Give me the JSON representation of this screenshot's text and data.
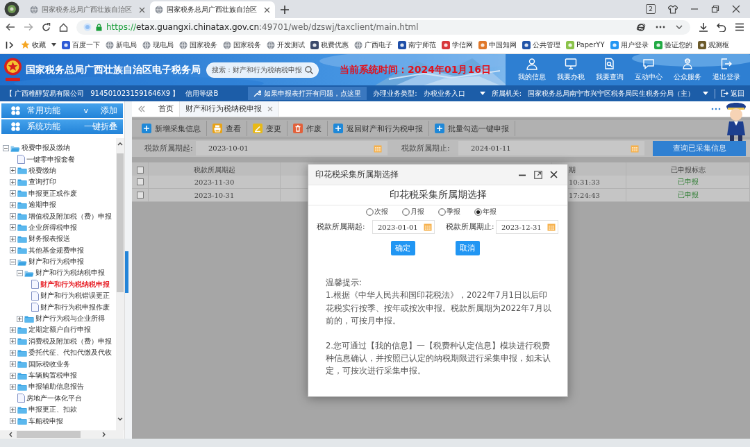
{
  "browser": {
    "tabs": [
      {
        "title": "国家税务总局广西壮族自治区",
        "selected": false
      },
      {
        "title": "国家税务总局广西壮族自治区",
        "selected": true
      }
    ],
    "tab_count": "2",
    "url": {
      "scheme": "https://",
      "host": "etax.guangxi.chinatax.gov.cn",
      "path": ":49701/web/dzswj/taxclient/main.html"
    },
    "bookmarks": [
      {
        "label": "收藏",
        "kind": "star"
      },
      {
        "label": "百度一下",
        "kind": "tile",
        "color": "#2f5bd6"
      },
      {
        "label": "新电局",
        "kind": "globe"
      },
      {
        "label": "现电局",
        "kind": "globe"
      },
      {
        "label": "国家税务",
        "kind": "globe"
      },
      {
        "label": "国家税务",
        "kind": "globe"
      },
      {
        "label": "开发测试",
        "kind": "globe"
      },
      {
        "label": "税费优惠",
        "kind": "tile",
        "color": "#3b4a6b"
      },
      {
        "label": "广西电子",
        "kind": "globe"
      },
      {
        "label": "南宁师范",
        "kind": "tile",
        "color": "#1f4fa8"
      },
      {
        "label": "学信网",
        "kind": "tile",
        "color": "#d8363a"
      },
      {
        "label": "中国知网",
        "kind": "tile",
        "color": "#e0782a"
      },
      {
        "label": "公共管理",
        "kind": "tile",
        "color": "#2254a8"
      },
      {
        "label": "PaperYY",
        "kind": "tile",
        "color": "#8bc34a"
      },
      {
        "label": "用户登录",
        "kind": "tile",
        "color": "#2196f3"
      },
      {
        "label": "验证您的",
        "kind": "tile",
        "color": "#22aa44"
      },
      {
        "label": "观测枢",
        "kind": "tile",
        "color": "#6b5a2a"
      }
    ]
  },
  "header": {
    "title": "国家税务总局广西壮族自治区电子税务局",
    "search": {
      "placeholder": "搜索：财产和行为税纳税申报"
    },
    "system_time": "当前系统时间：2024年01月16日",
    "nav": [
      {
        "label": "我的信息",
        "kind": "person"
      },
      {
        "label": "我要办税",
        "kind": "monitor"
      },
      {
        "label": "我要查询",
        "kind": "search"
      },
      {
        "label": "互动中心",
        "kind": "chat"
      },
      {
        "label": "公众服务",
        "kind": "people"
      },
      {
        "label": "退出登录",
        "kind": "exit"
      }
    ]
  },
  "info_bar": {
    "company": "【 广西稚醇贸易有限公司",
    "tax_id": "9145010231591646X9 】",
    "credit": "信用等级B",
    "help": "如果申报表打开有问题，点这里",
    "business_label": "办理业务类型:",
    "business_value": "办税业务入口",
    "authority_label": "所属机关:",
    "authority_value": "国家税务总局南宁市兴宁区税务局民生税务分局（主）",
    "back": "返回"
  },
  "sidebar": {
    "panels": [
      {
        "label": "常用功能",
        "toggle": "v",
        "action": "添加"
      },
      {
        "label": "系统功能",
        "action": "一键折叠"
      }
    ],
    "tree": [
      {
        "label": "税费申报及缴纳",
        "kind": "folder",
        "expanded": true,
        "selected": false,
        "children": [
          {
            "label": "一键零申报套餐",
            "kind": "file",
            "selected": false
          },
          {
            "label": "税费缴纳",
            "kind": "folder",
            "expanded": false,
            "selected": false
          },
          {
            "label": "查询打印",
            "kind": "folder",
            "expanded": false,
            "selected": false
          },
          {
            "label": "申报更正或作废",
            "kind": "folder",
            "expanded": false,
            "selected": false
          },
          {
            "label": "逾期申报",
            "kind": "folder",
            "expanded": false,
            "selected": false
          },
          {
            "label": "增值税及附加税（费）申报",
            "kind": "folder",
            "expanded": false,
            "selected": false
          },
          {
            "label": "企业所得税申报",
            "kind": "folder",
            "expanded": false,
            "selected": false
          },
          {
            "label": "财务报表报送",
            "kind": "folder",
            "expanded": false,
            "selected": false
          },
          {
            "label": "其他基金规费申报",
            "kind": "folder",
            "expanded": false,
            "selected": false
          },
          {
            "label": "财产和行为税申报",
            "kind": "folder",
            "expanded": true,
            "selected": false,
            "children": [
              {
                "label": "财产和行为税纳税申报",
                "kind": "folder",
                "expanded": true,
                "selected": false,
                "children": [
                  {
                    "label": "财产和行为税纳税申报",
                    "kind": "file",
                    "selected": true
                  },
                  {
                    "label": "财产和行为税错误更正",
                    "kind": "file",
                    "selected": false
                  },
                  {
                    "label": "财产和行为税申报作废",
                    "kind": "file",
                    "selected": false
                  }
                ]
              },
              {
                "label": "财产行为税与企业所得",
                "kind": "folder",
                "expanded": false,
                "selected": false
              }
            ]
          },
          {
            "label": "定期定额户自行申报",
            "kind": "folder",
            "expanded": false,
            "selected": false
          },
          {
            "label": "消费税及附加税（费）申报",
            "kind": "folder",
            "expanded": false,
            "selected": false
          },
          {
            "label": "委托代征、代扣代缴及代收",
            "kind": "folder",
            "expanded": false,
            "selected": false
          },
          {
            "label": "国际税收业务",
            "kind": "folder",
            "expanded": false,
            "selected": false
          },
          {
            "label": "车辆购置税申报",
            "kind": "folder",
            "expanded": false,
            "selected": false
          },
          {
            "label": "申报辅助信息报告",
            "kind": "folder",
            "expanded": false,
            "selected": false
          },
          {
            "label": "房地产一体化平台",
            "kind": "file",
            "selected": false
          },
          {
            "label": "申报更正、扣款",
            "kind": "folder",
            "expanded": false,
            "selected": false
          },
          {
            "label": "车船税申报",
            "kind": "folder",
            "expanded": false,
            "selected": false
          }
        ]
      }
    ]
  },
  "workspace": {
    "page_tabs": [
      {
        "label": "首页",
        "selected": false,
        "closable": false
      },
      {
        "label": "财产和行为税纳税申报",
        "selected": true,
        "closable": true
      }
    ],
    "toolbar": [
      {
        "label": "新增采集信息",
        "kind": "add"
      },
      {
        "label": "查看",
        "kind": "print"
      },
      {
        "label": "变更",
        "kind": "edit"
      },
      {
        "label": "作废",
        "kind": "delete"
      },
      {
        "label": "返回财产和行为税申报",
        "kind": "add"
      },
      {
        "label": "批量勾选一键申报",
        "kind": "add"
      }
    ],
    "filter": {
      "start_label": "税款所属期起:",
      "start_value": "2023-10-01",
      "end_label": "税款所属期止:",
      "end_value": "2024-01-11",
      "query_button": "查询已采集信息"
    },
    "table": {
      "select_all_checked": false,
      "columns": [
        "税款所属期起",
        "期",
        "已申报标志"
      ],
      "rows": [
        {
          "checked": false,
          "cells": [
            "2023-11-30",
            "10:31:33",
            "已申报"
          ]
        },
        {
          "checked": false,
          "cells": [
            "2023-10-31",
            "17:24:43",
            "已申报"
          ]
        }
      ]
    }
  },
  "dialog": {
    "title": "印花税采集所属期选择",
    "heading": "印花税采集所属期选择",
    "period_types": [
      {
        "label": "次报",
        "selected": false
      },
      {
        "label": "月报",
        "selected": false
      },
      {
        "label": "季报",
        "selected": false
      },
      {
        "label": "年报",
        "selected": true
      }
    ],
    "start_label": "税款所属期起:",
    "start_value": "2023-01-01",
    "end_label": "税款所属期止:",
    "end_value": "2023-12-31",
    "buttons": [
      "确定",
      "取消"
    ],
    "tips": {
      "title": "温馨提示:",
      "paragraphs": [
        "1.根据《中华人民共和国印花税法》，2022年7月1日以后印花税实行按季、按年或按次申报。税款所属期为2022年7月以前的，可按月申报。",
        "2.您可通过【我的信息】一【税费种认定信息】模块进行税费种信息确认，并按照已认定的纳税期限进行采集申报，如未认定，可按次进行采集申报。"
      ]
    }
  }
}
